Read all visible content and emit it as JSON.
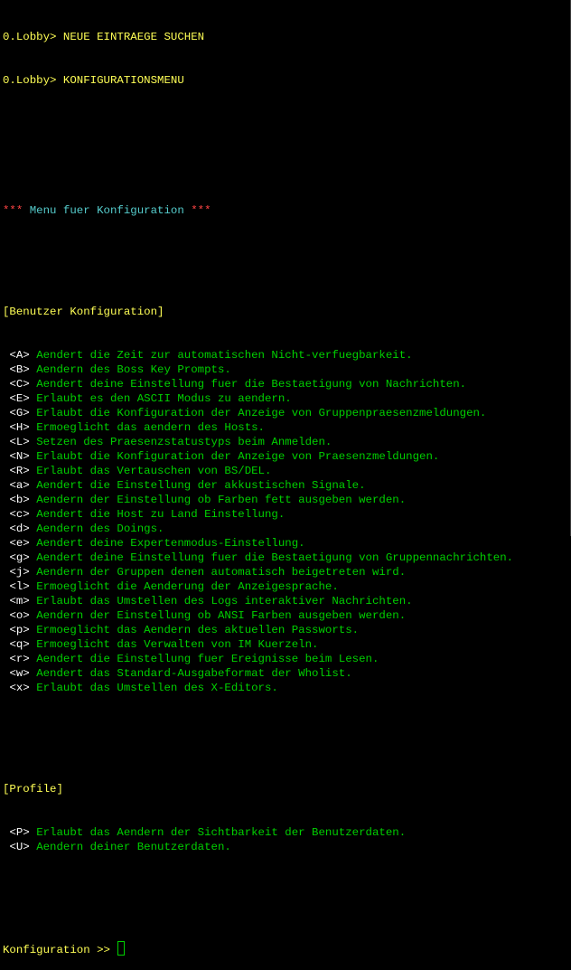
{
  "history": [
    "0.Lobby> NEUE EINTRAEGE SUCHEN",
    "0.Lobby> KONFIGURATIONSMENU"
  ],
  "menu_title": {
    "stars_left": "***",
    "text": " Menu fuer Konfiguration ",
    "stars_right": "***"
  },
  "sections": [
    {
      "header": "[Benutzer Konfiguration]",
      "items": [
        {
          "key": "<A>",
          "desc": "Aendert die Zeit zur automatischen Nicht-verfuegbarkeit."
        },
        {
          "key": "<B>",
          "desc": "Aendern des Boss Key Prompts."
        },
        {
          "key": "<C>",
          "desc": "Aendert deine Einstellung fuer die Bestaetigung von Nachrichten."
        },
        {
          "key": "<E>",
          "desc": "Erlaubt es den ASCII Modus zu aendern."
        },
        {
          "key": "<G>",
          "desc": "Erlaubt die Konfiguration der Anzeige von Gruppenpraesenzmeldungen."
        },
        {
          "key": "<H>",
          "desc": "Ermoeglicht das aendern des Hosts."
        },
        {
          "key": "<L>",
          "desc": "Setzen des Praesenzstatustyps beim Anmelden."
        },
        {
          "key": "<N>",
          "desc": "Erlaubt die Konfiguration der Anzeige von Praesenzmeldungen."
        },
        {
          "key": "<R>",
          "desc": "Erlaubt das Vertauschen von BS/DEL."
        },
        {
          "key": "<a>",
          "desc": "Aendert die Einstellung der akkustischen Signale."
        },
        {
          "key": "<b>",
          "desc": "Aendern der Einstellung ob Farben fett ausgeben werden."
        },
        {
          "key": "<c>",
          "desc": "Aendert die Host zu Land Einstellung."
        },
        {
          "key": "<d>",
          "desc": "Aendern des Doings."
        },
        {
          "key": "<e>",
          "desc": "Aendert deine Expertenmodus-Einstellung."
        },
        {
          "key": "<g>",
          "desc": "Aendert deine Einstellung fuer die Bestaetigung von Gruppennachrichten."
        },
        {
          "key": "<j>",
          "desc": "Aendern der Gruppen denen automatisch beigetreten wird."
        },
        {
          "key": "<l>",
          "desc": "Ermoeglicht die Aenderung der Anzeigesprache."
        },
        {
          "key": "<m>",
          "desc": "Erlaubt das Umstellen des Logs interaktiver Nachrichten."
        },
        {
          "key": "<o>",
          "desc": "Aendern der Einstellung ob ANSI Farben ausgeben werden."
        },
        {
          "key": "<p>",
          "desc": "Ermoeglicht das Aendern des aktuellen Passworts."
        },
        {
          "key": "<q>",
          "desc": "Ermoeglicht das Verwalten von IM Kuerzeln."
        },
        {
          "key": "<r>",
          "desc": "Aendert die Einstellung fuer Ereignisse beim Lesen."
        },
        {
          "key": "<w>",
          "desc": "Aendert das Standard-Ausgabeformat der Wholist."
        },
        {
          "key": "<x>",
          "desc": "Erlaubt das Umstellen des X-Editors."
        }
      ]
    },
    {
      "header": "[Profile]",
      "items": [
        {
          "key": "<P>",
          "desc": "Erlaubt das Aendern der Sichtbarkeit der Benutzerdaten."
        },
        {
          "key": "<U>",
          "desc": "Aendern deiner Benutzerdaten."
        }
      ]
    }
  ],
  "prompt": "Konfiguration >> ",
  "colors": {
    "background": "#000000",
    "command": "#ffff55",
    "stars": "#ff4444",
    "title": "#55cccc",
    "key": "#ffffff",
    "description": "#00d000"
  }
}
